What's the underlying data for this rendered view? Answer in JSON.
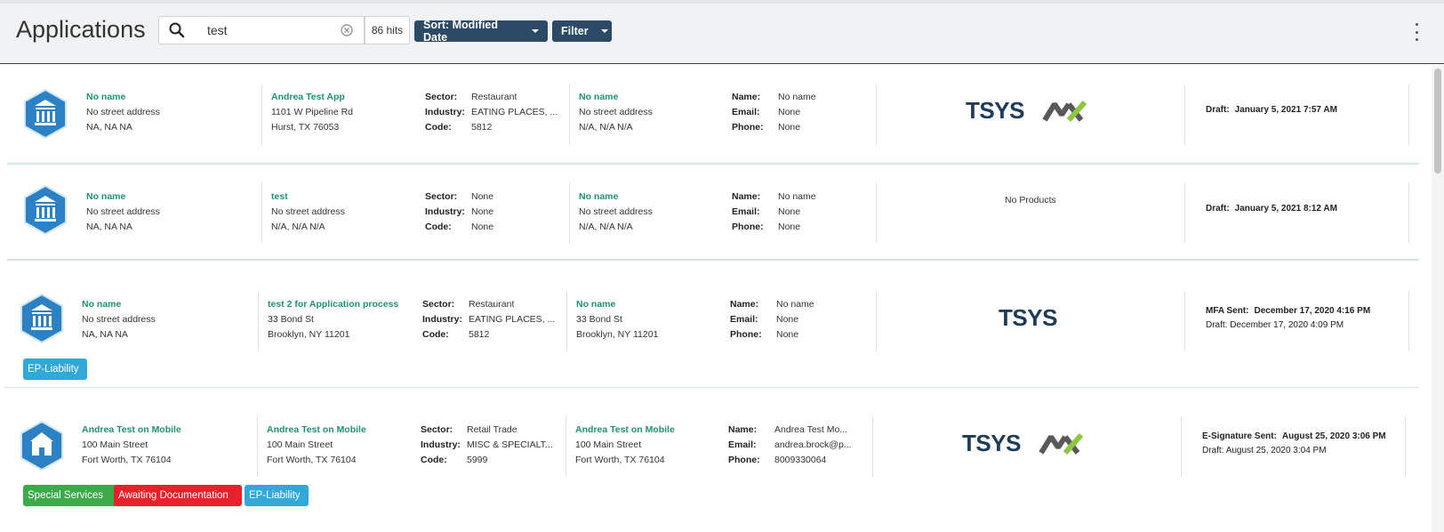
{
  "header": {
    "title": "Applications",
    "search_value": "test",
    "hits": "86 hits",
    "sort_label": "Sort: Modified Date",
    "filter_label": "Filter"
  },
  "labels": {
    "sector": "Sector:",
    "industry": "Industry:",
    "code": "Code:",
    "name": "Name:",
    "email": "Email:",
    "phone": "Phone:"
  },
  "rows": [
    {
      "merchant": {
        "name": "No name",
        "street": "No street address",
        "city": "NA, NA NA"
      },
      "app": {
        "name": "Andrea Test App",
        "street": "1101 W Pipeline Rd",
        "city": "Hurst, TX 76053"
      },
      "sector": "Restaurant",
      "industry": "EATING PLACES, ...",
      "code": "5812",
      "location": {
        "name": "No name",
        "street": "No street address",
        "city": "N/A, N/A N/A"
      },
      "contact": {
        "name": "No name",
        "email": "None",
        "phone": "None"
      },
      "status": {
        "label": "Draft:",
        "date": "January 5, 2021 7:57 AM"
      }
    },
    {
      "merchant": {
        "name": "No name",
        "street": "No street address",
        "city": "NA, NA NA"
      },
      "app": {
        "name": "test",
        "street": "No street address",
        "city": "N/A, N/A N/A"
      },
      "sector": "None",
      "industry": "None",
      "code": "None",
      "location": {
        "name": "No name",
        "street": "No street address",
        "city": "N/A, N/A N/A"
      },
      "contact": {
        "name": "No name",
        "email": "None",
        "phone": "None"
      },
      "products_text": "No Products",
      "status": {
        "label": "Draft:",
        "date": "January 5, 2021 8:12 AM"
      }
    },
    {
      "merchant": {
        "name": "No name",
        "street": "No street address",
        "city": "NA, NA NA"
      },
      "app": {
        "name": "test 2 for Application process",
        "street": "33 Bond St",
        "city": "Brooklyn, NY 11201"
      },
      "sector": "Restaurant",
      "industry": "EATING PLACES, ...",
      "code": "5812",
      "location": {
        "name": "No name",
        "street": "33 Bond St",
        "city": "Brooklyn, NY 11201"
      },
      "contact": {
        "name": "No name",
        "email": "None",
        "phone": "None"
      },
      "status": {
        "label": "MFA Sent:",
        "date": "December 17, 2020 4:16 PM",
        "sub_label": "Draft:",
        "sub_date": "December 17, 2020 4:09 PM"
      },
      "tags": [
        "EP-Liability"
      ]
    },
    {
      "merchant": {
        "name": "Andrea Test on Mobile",
        "street": "100 Main Street",
        "city": "Fort Worth, TX 76104"
      },
      "app": {
        "name": "Andrea Test on Mobile",
        "street": "100 Main Street",
        "city": "Fort Worth, TX 76104"
      },
      "sector": "Retail Trade",
      "industry": "MISC & SPECIALT...",
      "code": "5999",
      "location": {
        "name": "Andrea Test on Mobile",
        "street": "100 Main Street",
        "city": "Fort Worth, TX 76104"
      },
      "contact": {
        "name": "Andrea Test Mo...",
        "email": "andrea.brock@p...",
        "phone": "8009330064"
      },
      "status": {
        "label": "E-Signature Sent:",
        "date": "August 25, 2020 3:06 PM",
        "sub_label": "Draft:",
        "sub_date": "August 25, 2020 3:04 PM"
      },
      "tags": [
        "Special Services",
        "Awaiting Documentation",
        "EP-Liability"
      ]
    }
  ],
  "product_logos": {
    "tsys": "TSYS"
  },
  "colors": {
    "teal": "#1f9177",
    "navy": "#2c4a66",
    "tag_blue": "#31a8d8",
    "tag_green": "#3daa4a",
    "tag_red": "#e8202a"
  }
}
